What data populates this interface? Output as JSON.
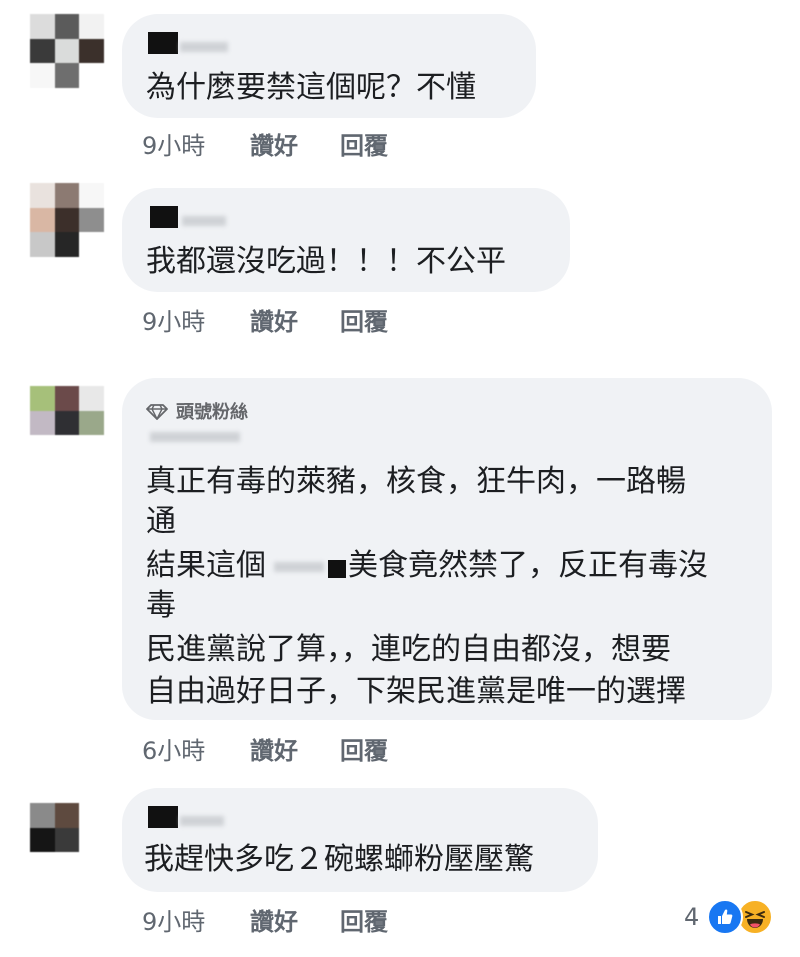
{
  "comments": [
    {
      "text_lines": [
        "為什麼要禁這個呢？不懂"
      ],
      "time": "9小時",
      "like": "讚好",
      "reply": "回覆"
    },
    {
      "text_lines": [
        "我都還沒吃過！！！不公平"
      ],
      "time": "9小時",
      "like": "讚好",
      "reply": "回覆"
    },
    {
      "badge": "頭號粉絲",
      "text_lines": [
        "真正有毒的萊豬，核食，狂牛肉，一路暢",
        "通",
        "結果這個",
        "美食竟然禁了，反正有毒沒",
        "毒",
        "民進黨說了算，，連吃的自由都沒，想要",
        "自由過好日子，下架民進黨是唯一的選擇"
      ],
      "time": "6小時",
      "like": "讚好",
      "reply": "回覆"
    },
    {
      "text_lines": [
        "我趕快多吃２碗螺螄粉壓壓驚"
      ],
      "time": "9小時",
      "like": "讚好",
      "reply": "回覆",
      "reaction_count": "4"
    }
  ],
  "icons": {
    "badge": "diamond-icon",
    "like_reaction": "thumbs-up-icon",
    "haha_reaction": "laughing-face-icon"
  },
  "colors": {
    "bubble": "#f0f2f5",
    "like_blue": "#1877f2",
    "haha_yellow": "#f7b125",
    "meta_gray": "#606770"
  }
}
